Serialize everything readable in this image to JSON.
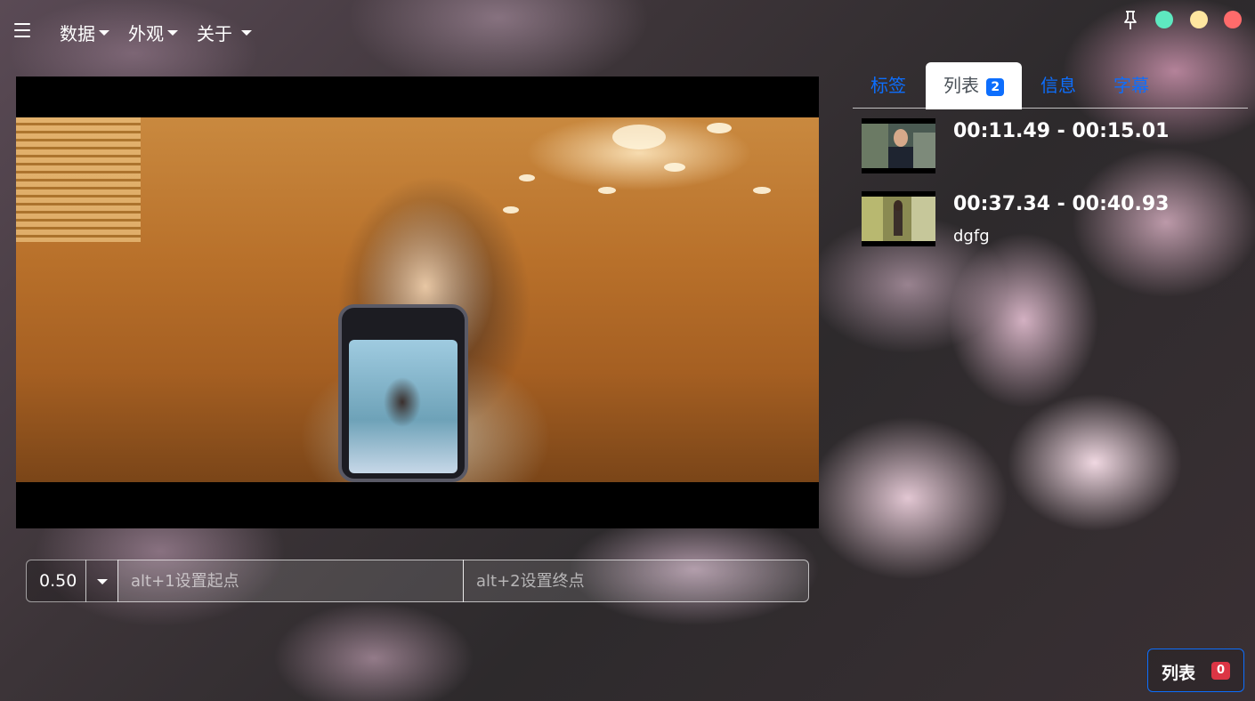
{
  "navbar": {
    "menus": [
      {
        "label": "数据"
      },
      {
        "label": "外观"
      },
      {
        "label": "关于"
      }
    ],
    "window_controls": {
      "pin_icon": "pin-icon",
      "minimize_color": "#5ee8c0",
      "maximize_color": "#ffe6a0",
      "close_color": "#ff6b6b"
    }
  },
  "tabs": [
    {
      "label": "标签",
      "active": false
    },
    {
      "label": "列表",
      "active": true,
      "badge": "2"
    },
    {
      "label": "信息",
      "active": false
    },
    {
      "label": "字幕",
      "active": false
    }
  ],
  "clips": [
    {
      "time": "00:11.49 - 00:15.01",
      "note": ""
    },
    {
      "time": "00:37.34 - 00:40.93",
      "note": "dgfg"
    }
  ],
  "controls": {
    "rate_value": "0.50",
    "start_placeholder": "alt+1设置起点",
    "end_placeholder": "alt+2设置终点"
  },
  "list_button": {
    "label": "列表",
    "badge": "0"
  },
  "colors": {
    "accent": "#0d6efd",
    "danger": "#dc3545"
  }
}
